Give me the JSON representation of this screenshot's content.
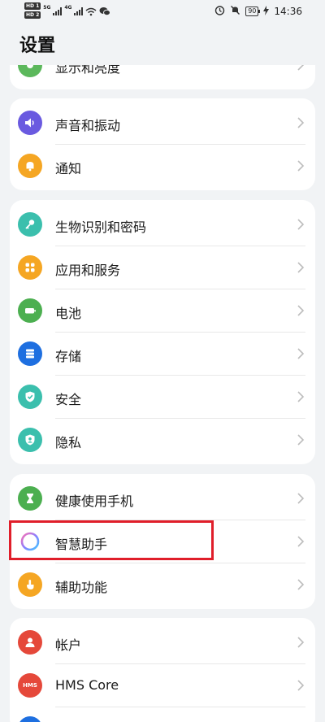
{
  "status_bar": {
    "hd1": "HD 1",
    "hd2": "HD 2",
    "net1": "5G",
    "net2": "4G",
    "battery": "90",
    "time": "14:36"
  },
  "page": {
    "title": "设置"
  },
  "groups": [
    {
      "items": [
        {
          "label": "显示和亮度",
          "icon": "display-icon",
          "color": "#5cb85c"
        }
      ]
    },
    {
      "items": [
        {
          "label": "声音和振动",
          "icon": "speaker-icon",
          "color": "#6a5ae0"
        },
        {
          "label": "通知",
          "icon": "bell-icon",
          "color": "#f5a623"
        }
      ]
    },
    {
      "items": [
        {
          "label": "生物识别和密码",
          "icon": "key-icon",
          "color": "#3bbfad"
        },
        {
          "label": "应用和服务",
          "icon": "apps-icon",
          "color": "#f5a623"
        },
        {
          "label": "电池",
          "icon": "battery-icon",
          "color": "#4caf50"
        },
        {
          "label": "存储",
          "icon": "storage-icon",
          "color": "#1e6fe0"
        },
        {
          "label": "安全",
          "icon": "shield-icon",
          "color": "#3bbfad"
        },
        {
          "label": "隐私",
          "icon": "privacy-icon",
          "color": "#3bbfad"
        }
      ]
    },
    {
      "items": [
        {
          "label": "健康使用手机",
          "icon": "hourglass-icon",
          "color": "#4caf50"
        },
        {
          "label": "智慧助手",
          "icon": "assistant-ring-icon",
          "color": "#8a7fff"
        },
        {
          "label": "辅助功能",
          "icon": "hand-icon",
          "color": "#f5a623"
        }
      ]
    },
    {
      "items": [
        {
          "label": "帐户",
          "icon": "account-icon",
          "color": "#e5483a"
        },
        {
          "label": "HMS Core",
          "icon": "hms-icon",
          "color": "#e5483a",
          "icon_text": "HMS"
        }
      ]
    }
  ]
}
